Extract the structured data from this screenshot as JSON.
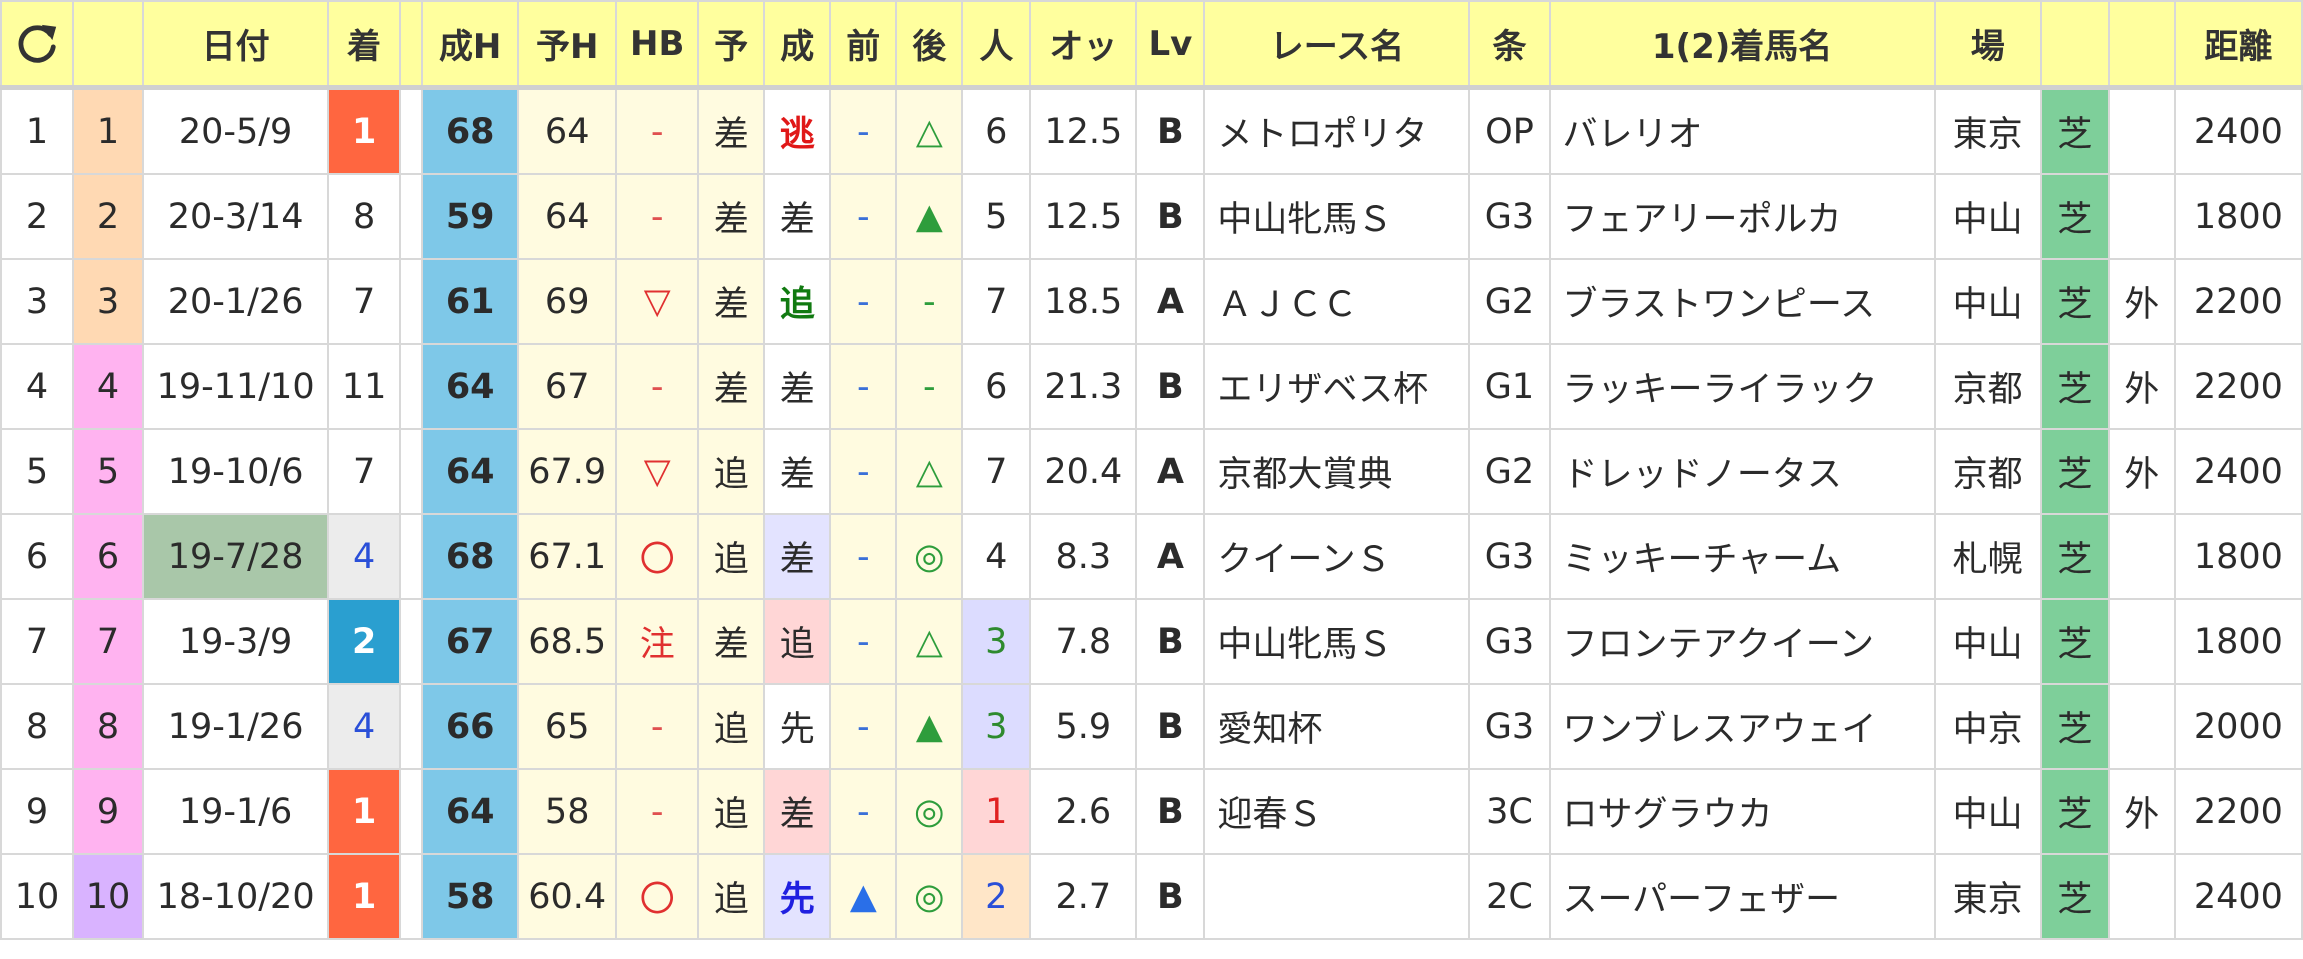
{
  "headers": {
    "refresh": "",
    "blank": "",
    "date": "日付",
    "finish": "着",
    "blank2": "",
    "result_h": "成H",
    "pred_h": "予H",
    "hb": "HB",
    "pred": "予",
    "result": "成",
    "front": "前",
    "back": "後",
    "pop": "人",
    "odds": "オッ",
    "lv": "Lv",
    "race_name": "レース名",
    "cond": "条",
    "winner": "1(2)着馬名",
    "venue": "場",
    "surface": "",
    "course": "",
    "distance": "距離"
  },
  "colors": {
    "header_bg": "#ffff9e",
    "rank_blue": "#7ec8e8",
    "turf_green": "#7ecf9a",
    "win_red": "#ff6640",
    "second_blue": "#2a9fd0"
  },
  "rows": [
    {
      "no": "1",
      "idx": "1",
      "date": "20-5/9",
      "finish": "1",
      "result_h": "68",
      "pred_h": "64",
      "hb": "-",
      "pred": "差",
      "result": "逃",
      "front": "-",
      "back": "△",
      "pop": "6",
      "odds": "12.5",
      "lv": "B",
      "race": "メトロポリタ",
      "cond": "OP",
      "winner": "バレリオ",
      "venue": "東京",
      "surface": "芝",
      "course": "",
      "dist": "2400"
    },
    {
      "no": "2",
      "idx": "2",
      "date": "20-3/14",
      "finish": "8",
      "result_h": "59",
      "pred_h": "64",
      "hb": "-",
      "pred": "差",
      "result": "差",
      "front": "-",
      "back": "▲",
      "pop": "5",
      "odds": "12.5",
      "lv": "B",
      "race": "中山牝馬Ｓ",
      "cond": "G3",
      "winner": "フェアリーポルカ",
      "venue": "中山",
      "surface": "芝",
      "course": "",
      "dist": "1800"
    },
    {
      "no": "3",
      "idx": "3",
      "date": "20-1/26",
      "finish": "7",
      "result_h": "61",
      "pred_h": "69",
      "hb": "▽",
      "pred": "差",
      "result": "追",
      "front": "-",
      "back": "-",
      "pop": "7",
      "odds": "18.5",
      "lv": "A",
      "race": "ＡＪＣＣ",
      "cond": "G2",
      "winner": "ブラストワンピース",
      "venue": "中山",
      "surface": "芝",
      "course": "外",
      "dist": "2200"
    },
    {
      "no": "4",
      "idx": "4",
      "date": "19-11/10",
      "finish": "11",
      "result_h": "64",
      "pred_h": "67",
      "hb": "-",
      "pred": "差",
      "result": "差",
      "front": "-",
      "back": "-",
      "pop": "6",
      "odds": "21.3",
      "lv": "B",
      "race": "エリザベス杯",
      "cond": "G1",
      "winner": "ラッキーライラック",
      "venue": "京都",
      "surface": "芝",
      "course": "外",
      "dist": "2200"
    },
    {
      "no": "5",
      "idx": "5",
      "date": "19-10/6",
      "finish": "7",
      "result_h": "64",
      "pred_h": "67.9",
      "hb": "▽",
      "pred": "追",
      "result": "差",
      "front": "-",
      "back": "△",
      "pop": "7",
      "odds": "20.4",
      "lv": "A",
      "race": "京都大賞典",
      "cond": "G2",
      "winner": "ドレッドノータス",
      "venue": "京都",
      "surface": "芝",
      "course": "外",
      "dist": "2400"
    },
    {
      "no": "6",
      "idx": "6",
      "date": "19-7/28",
      "finish": "4",
      "result_h": "68",
      "pred_h": "67.1",
      "hb": "〇",
      "pred": "追",
      "result": "差",
      "front": "-",
      "back": "◎",
      "pop": "4",
      "odds": "8.3",
      "lv": "A",
      "race": "クイーンＳ",
      "cond": "G3",
      "winner": "ミッキーチャーム",
      "venue": "札幌",
      "surface": "芝",
      "course": "",
      "dist": "1800"
    },
    {
      "no": "7",
      "idx": "7",
      "date": "19-3/9",
      "finish": "2",
      "result_h": "67",
      "pred_h": "68.5",
      "hb": "注",
      "pred": "差",
      "result": "追",
      "front": "-",
      "back": "△",
      "pop": "3",
      "odds": "7.8",
      "lv": "B",
      "race": "中山牝馬Ｓ",
      "cond": "G3",
      "winner": "フロンテアクイーン",
      "venue": "中山",
      "surface": "芝",
      "course": "",
      "dist": "1800"
    },
    {
      "no": "8",
      "idx": "8",
      "date": "19-1/26",
      "finish": "4",
      "result_h": "66",
      "pred_h": "65",
      "hb": "-",
      "pred": "追",
      "result": "先",
      "front": "-",
      "back": "▲",
      "pop": "3",
      "odds": "5.9",
      "lv": "B",
      "race": "愛知杯",
      "cond": "G3",
      "winner": "ワンブレスアウェイ",
      "venue": "中京",
      "surface": "芝",
      "course": "",
      "dist": "2000"
    },
    {
      "no": "9",
      "idx": "9",
      "date": "19-1/6",
      "finish": "1",
      "result_h": "64",
      "pred_h": "58",
      "hb": "-",
      "pred": "追",
      "result": "差",
      "front": "-",
      "back": "◎",
      "pop": "1",
      "odds": "2.6",
      "lv": "B",
      "race": "迎春Ｓ",
      "cond": "3C",
      "winner": "ロサグラウカ",
      "venue": "中山",
      "surface": "芝",
      "course": "外",
      "dist": "2200"
    },
    {
      "no": "10",
      "idx": "10",
      "date": "18-10/20",
      "finish": "1",
      "result_h": "58",
      "pred_h": "60.4",
      "hb": "〇",
      "pred": "追",
      "result": "先",
      "front": "▲",
      "back": "◎",
      "pop": "2",
      "odds": "2.7",
      "lv": "B",
      "race": "",
      "cond": "2C",
      "winner": "スーパーフェザー",
      "venue": "東京",
      "surface": "芝",
      "course": "",
      "dist": "2400"
    }
  ]
}
